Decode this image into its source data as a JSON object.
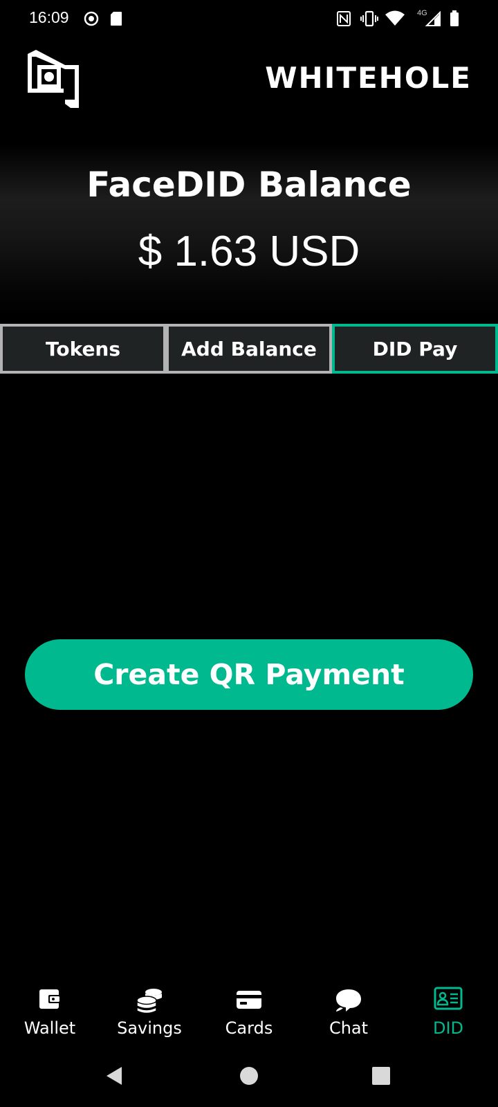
{
  "status_bar": {
    "time": "16:09",
    "network": "4G",
    "icons": [
      "screen-record-icon",
      "sd-card-icon",
      "nfc-icon",
      "vibrate-icon",
      "wifi-icon",
      "signal-icon",
      "battery-icon"
    ]
  },
  "header": {
    "logo_icon": "whitehole-logo-icon",
    "brand": "WHITEHOLE"
  },
  "balance": {
    "title": "FaceDID Balance",
    "amount": "$ 1.63 USD"
  },
  "tabs": [
    {
      "label": "Tokens",
      "active": false
    },
    {
      "label": "Add Balance",
      "active": false
    },
    {
      "label": "DID Pay",
      "active": true
    }
  ],
  "actions": {
    "create_qr_payment": "Create QR Payment"
  },
  "bottom_nav": [
    {
      "label": "Wallet",
      "icon": "wallet-icon",
      "active": false
    },
    {
      "label": "Savings",
      "icon": "coins-icon",
      "active": false
    },
    {
      "label": "Cards",
      "icon": "card-icon",
      "active": false
    },
    {
      "label": "Chat",
      "icon": "chat-icon",
      "active": false
    },
    {
      "label": "DID",
      "icon": "id-card-icon",
      "active": true
    }
  ],
  "colors": {
    "accent": "#00b98f",
    "background": "#000000",
    "tab_background": "#1f2324",
    "tab_border": "#b3b3b3"
  }
}
